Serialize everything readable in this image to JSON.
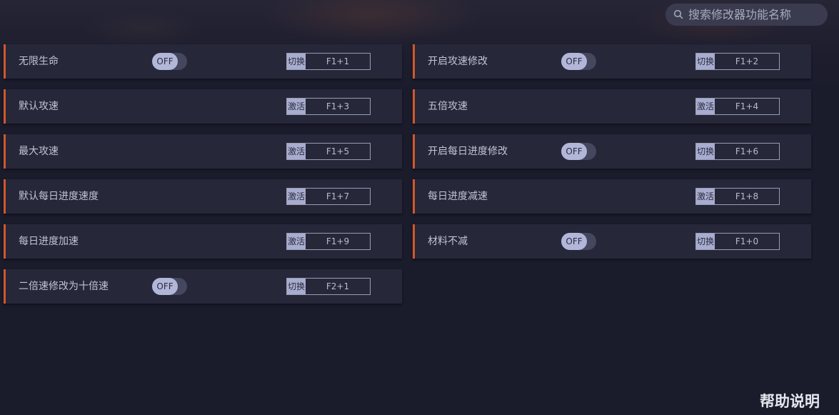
{
  "search": {
    "placeholder": "搜索修改器功能名称",
    "icon": "search-icon"
  },
  "cheats": [
    {
      "label": "无限生命",
      "toggle": "OFF",
      "tag": "切换",
      "keys": "F1+1"
    },
    {
      "label": "开启攻速修改",
      "toggle": "OFF",
      "tag": "切换",
      "keys": "F1+2"
    },
    {
      "label": "默认攻速",
      "tag": "激活",
      "keys": "F1+3"
    },
    {
      "label": "五倍攻速",
      "tag": "激活",
      "keys": "F1+4"
    },
    {
      "label": "最大攻速",
      "tag": "激活",
      "keys": "F1+5"
    },
    {
      "label": "开启每日进度修改",
      "toggle": "OFF",
      "tag": "切换",
      "keys": "F1+6"
    },
    {
      "label": "默认每日进度速度",
      "tag": "激活",
      "keys": "F1+7"
    },
    {
      "label": "每日进度减速",
      "tag": "激活",
      "keys": "F1+8"
    },
    {
      "label": "每日进度加速",
      "tag": "激活",
      "keys": "F1+9"
    },
    {
      "label": "材料不减",
      "toggle": "OFF",
      "tag": "切换",
      "keys": "F1+0"
    },
    {
      "label": "二倍速修改为十倍速",
      "toggle": "OFF",
      "tag": "切换",
      "keys": "F2+1"
    }
  ],
  "help": {
    "label": "帮助说明"
  },
  "colors": {
    "accent": "#d2572a",
    "background": "#1a1b2b",
    "card": "#262739",
    "toggle_knob": "#b2b6d8"
  }
}
